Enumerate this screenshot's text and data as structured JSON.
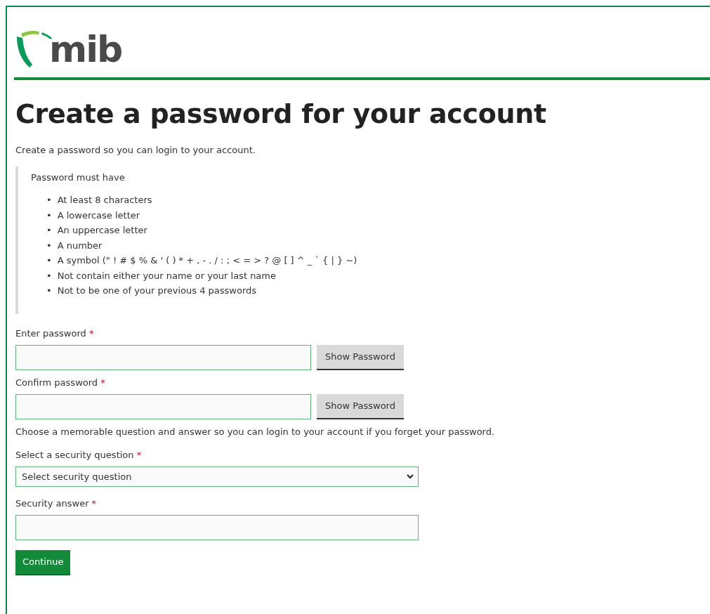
{
  "logo": {
    "text": "mib"
  },
  "heading": "Create a password for your account",
  "intro": "Create a password so you can login to your account.",
  "rules": {
    "title": "Password must have",
    "items": [
      {
        "bullet": "•",
        "text": "At least 8 characters"
      },
      {
        "bullet": "•",
        "text": "A lowercase letter"
      },
      {
        "bullet": "•",
        "text": "An uppercase letter"
      },
      {
        "bullet": "•",
        "text": "A number"
      },
      {
        "bullet": "•",
        "text": "A symbol (\" ! # $ % & ' ( ) * + , - . / : ; < = > ? @ [ ] ^ _ ` { | } ~)"
      },
      {
        "bullet": "•",
        "text": "Not contain either your name or your last name"
      },
      {
        "bullet": "•",
        "text": "Not to be one of your previous 4 passwords"
      }
    ]
  },
  "password_fields": [
    {
      "label": "Enter password",
      "required_mark": "*",
      "button": "Show Password"
    },
    {
      "label": "Confirm password",
      "required_mark": "*",
      "button": "Show Password"
    }
  ],
  "memorable_hint": "Choose a memorable question and answer so you can login to your account if you forget your password.",
  "security_question": {
    "label": "Select a security question",
    "required_mark": "*",
    "value": "Select security question"
  },
  "security_answer": {
    "label": "Security answer",
    "required_mark": "*"
  },
  "submit": "Continue"
}
